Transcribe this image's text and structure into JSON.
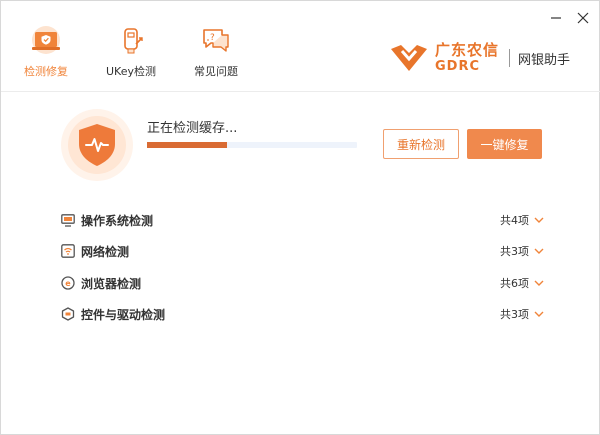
{
  "window": {
    "minimize_icon": "minimize-icon",
    "close_icon": "close-icon"
  },
  "nav": {
    "items": [
      {
        "label": "检测修复",
        "icon": "laptop-shield-icon",
        "active": true
      },
      {
        "label": "UKey检测",
        "icon": "ukey-icon",
        "active": false
      },
      {
        "label": "常见问题",
        "icon": "chat-question-icon",
        "active": false
      }
    ]
  },
  "brand": {
    "name_cn": "广东农信",
    "name_en": "GDRC",
    "product": "网银助手",
    "color": "#e8752b"
  },
  "scan": {
    "status": "正在检测缓存...",
    "progress": 0.38,
    "recheck_label": "重新检测",
    "fix_label": "一键修复"
  },
  "categories": [
    {
      "label": "操作系统检测",
      "count": "共4项",
      "icon": "monitor-icon"
    },
    {
      "label": "网络检测",
      "count": "共3项",
      "icon": "wifi-icon"
    },
    {
      "label": "浏览器检测",
      "count": "共6项",
      "icon": "browser-icon"
    },
    {
      "label": "控件与驱动检测",
      "count": "共3项",
      "icon": "plugin-icon"
    }
  ],
  "colors": {
    "accent": "#f0843a",
    "progress": "#d96b33"
  }
}
